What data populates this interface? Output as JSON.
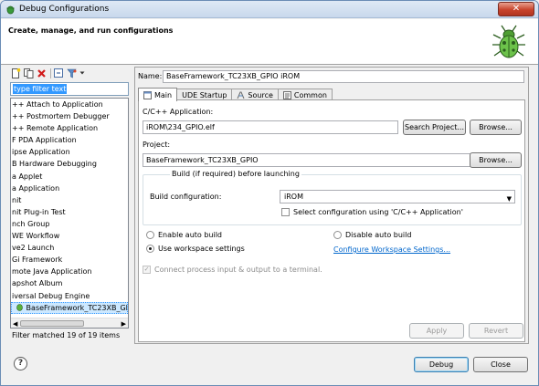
{
  "window": {
    "title": "Debug Configurations",
    "close_label": "✕"
  },
  "header": {
    "text": "Create, manage, and run configurations"
  },
  "filter": {
    "value": "type filter text"
  },
  "tree": {
    "items": [
      "++ Attach to Application",
      "++ Postmortem Debugger",
      "++ Remote Application",
      "F PDA Application",
      "ipse Application",
      "B Hardware Debugging",
      "a Applet",
      "a Application",
      "nit",
      "nit Plug-in Test",
      "nch Group",
      "WE Workflow",
      "ve2 Launch",
      "Gi Framework",
      "mote Java Application",
      "apshot Album",
      "iversal Debug Engine"
    ],
    "selected_child": "BaseFramework_TC23XB_GPIO"
  },
  "status": {
    "filtered": "Filter matched 19 of 19 items"
  },
  "config": {
    "name_label": "Name:",
    "name_value": "BaseFramework_TC23XB_GPIO iROM",
    "tabs": [
      {
        "label": "Main"
      },
      {
        "label": "UDE Startup"
      },
      {
        "label": "Source"
      },
      {
        "label": "Common"
      }
    ],
    "app_label": "C/C++ Application:",
    "app_value": "iROM\\234_GPIO.elf",
    "search_project_label": "Search Project...",
    "browse_label": "Browse...",
    "project_label": "Project:",
    "project_value": "BaseFramework_TC23XB_GPIO",
    "build_group_label": "Build (if required) before launching",
    "build_config_label": "Build configuration:",
    "build_config_value": "iROM",
    "select_config_label": "Select configuration using 'C/C++ Application'",
    "enable_auto_build": "Enable auto build",
    "disable_auto_build": "Disable auto build",
    "use_workspace": "Use workspace settings",
    "configure_workspace": "Configure Workspace Settings...",
    "connect_process": "Connect process input & output to a terminal.",
    "apply_label": "Apply",
    "revert_label": "Revert"
  },
  "footer": {
    "help": "?",
    "debug_label": "Debug",
    "close_label": "Close"
  }
}
